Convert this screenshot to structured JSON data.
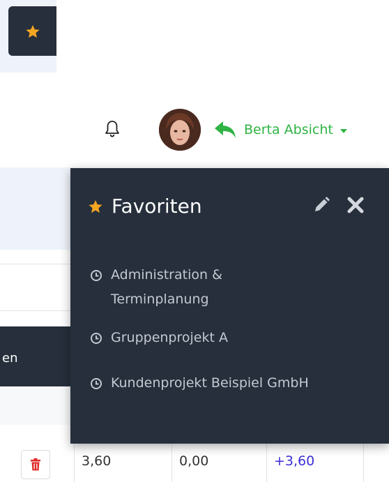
{
  "header": {
    "user_name": "Berta Absicht"
  },
  "favorites_panel": {
    "title": "Favoriten",
    "items": [
      {
        "label_line1": "Administration &",
        "label_line2": "Terminplanung"
      },
      {
        "label_line1": "Gruppenprojekt A"
      },
      {
        "label_line1": "Kundenprojekt Beispiel GmbH"
      }
    ]
  },
  "table": {
    "column_header_fragment": "en",
    "row": {
      "values": [
        "3,60",
        "0,00",
        "+3,60"
      ]
    }
  },
  "colors": {
    "accent_star": "#f5a623",
    "user_green": "#2fb344",
    "panel_bg": "#262f3b",
    "positive_value": "#3b2fd6"
  },
  "icons": {
    "favorite_button": "star-icon",
    "notifications": "bell-icon",
    "back": "reply-arrow-icon",
    "edit": "pencil-icon",
    "close": "close-icon",
    "item": "clock-icon",
    "delete": "trash-icon"
  }
}
